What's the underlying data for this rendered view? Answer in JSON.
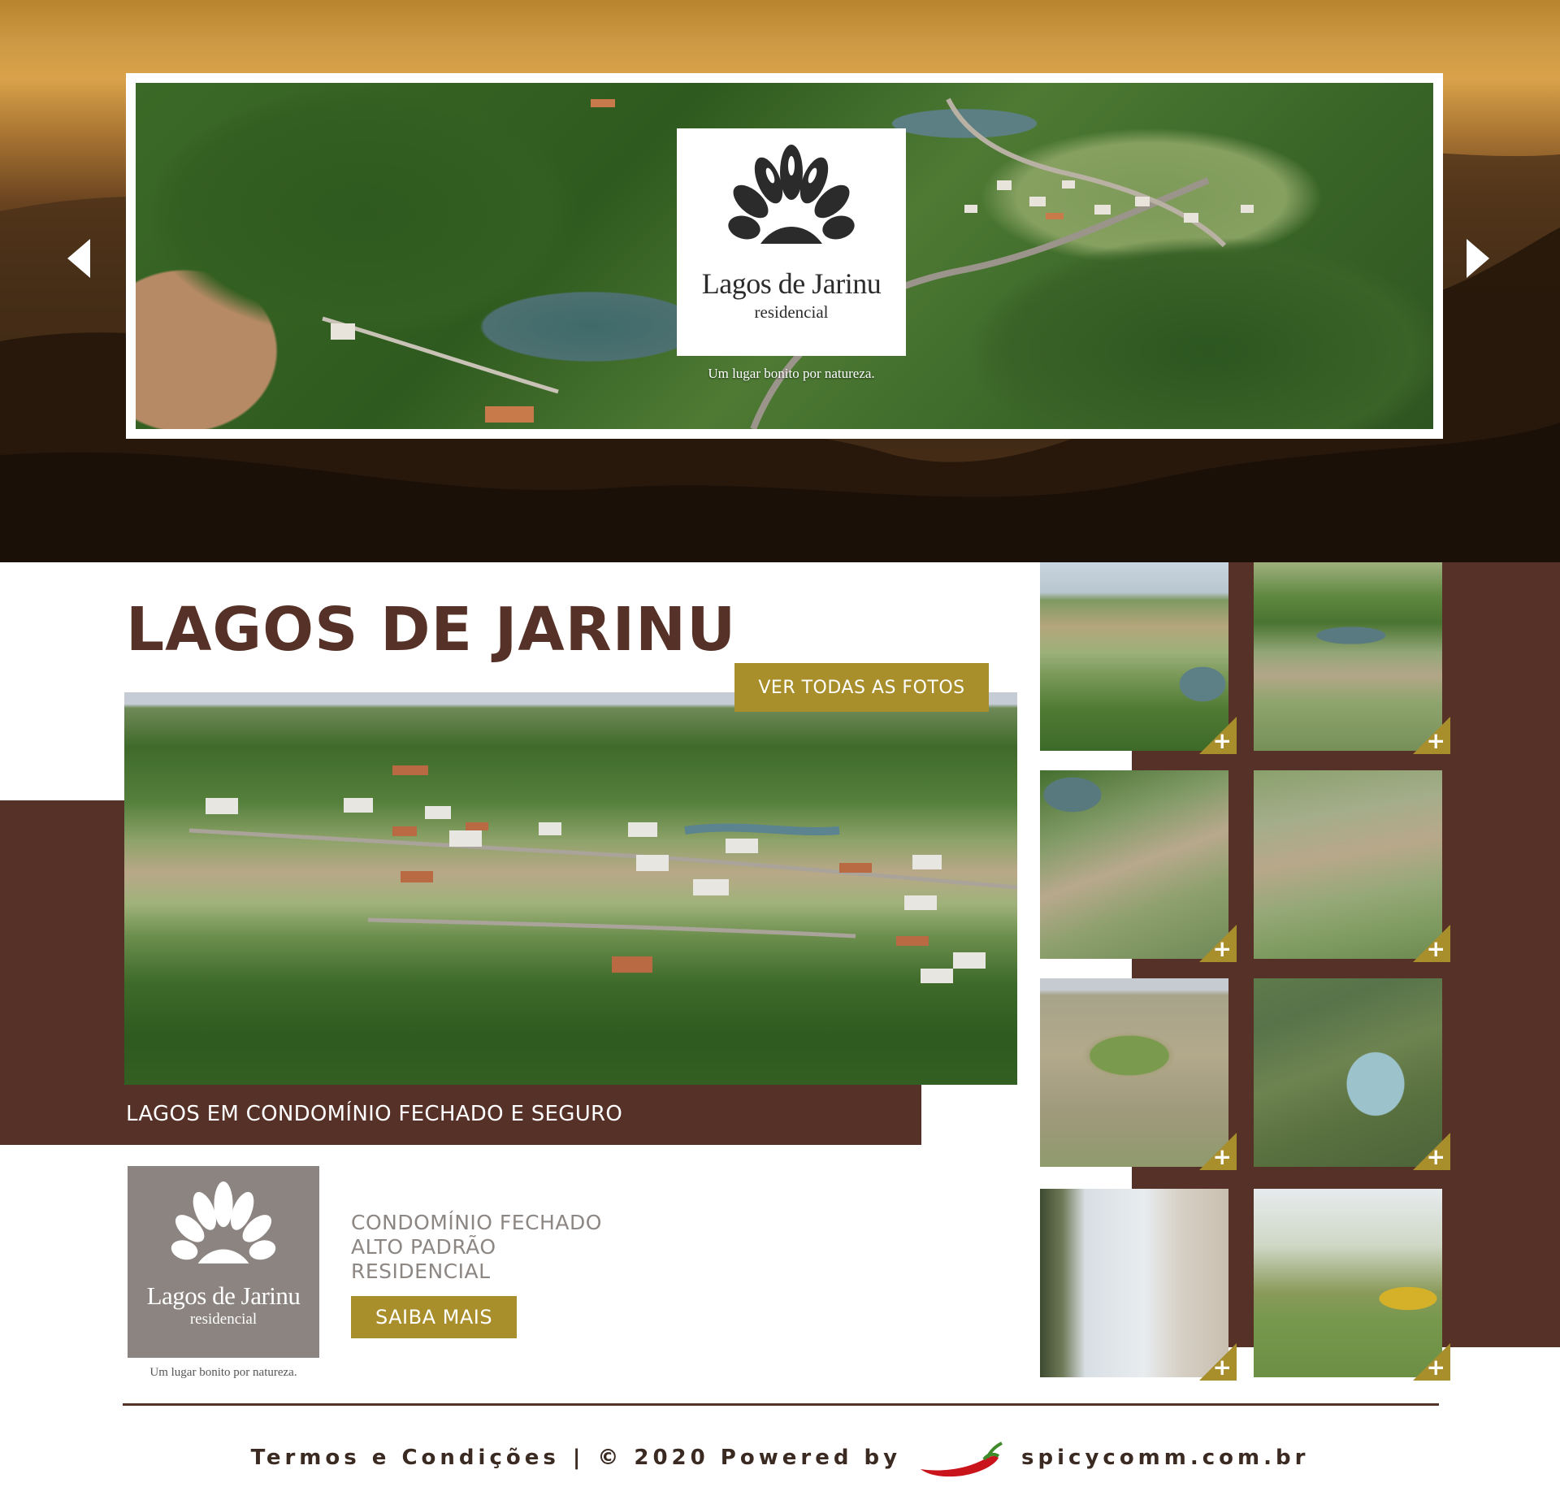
{
  "hero": {
    "logo_name": "Lagos de Jarinu",
    "logo_sub": "residencial",
    "tagline": "Um lugar bonito por natureza."
  },
  "main": {
    "title": "LAGOS DE JARINU",
    "photos_button": "VER TODAS AS FOTOS",
    "caption": "LAGOS EM CONDOMÍNIO FECHADO E SEGURO"
  },
  "brand": {
    "logo_name": "Lagos de Jarinu",
    "logo_sub": "residencial",
    "tagline": "Um lugar bonito por natureza."
  },
  "info": {
    "lines": [
      "CONDOMÍNIO FECHADO",
      "ALTO PADRÃO",
      "RESIDENCIAL"
    ],
    "cta": "SAIBA MAIS"
  },
  "thumbnails": {
    "plus": "+"
  },
  "footer": {
    "terms": "Termos e Condições",
    "separator": "|",
    "copyright": "© 2020 Powered by",
    "site": "spicycomm.com.br"
  },
  "colors": {
    "brown": "#563127",
    "gold": "#a88f2c",
    "grey_logo": "#8b8481",
    "info_text": "#8d8784"
  },
  "icons": [
    "chevron-left-icon",
    "chevron-right-icon",
    "shell-logo-icon",
    "plus-icon",
    "chili-pepper-icon"
  ]
}
